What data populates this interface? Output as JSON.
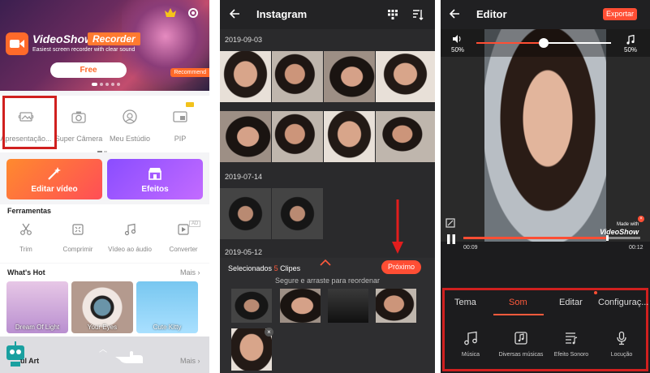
{
  "panel1": {
    "brand": "VideoShow",
    "brand_tag": "Recorder",
    "brand_sub": "Easiest screen recorder with clear sound",
    "free_label": "Free",
    "recommend": "Recommend",
    "tools": [
      "Apresentação...",
      "Super Câmera",
      "Meu Estúdio",
      "PIP"
    ],
    "edit_video": "Editar vídeo",
    "effects": "Efeitos",
    "ferramentas": "Ferramentas",
    "ftools": [
      "Trim",
      "Comprimir",
      "Vídeo ao áudio",
      "Converter"
    ],
    "ad_badge": "AD",
    "whats_hot": "What's Hot",
    "mais": "Mais",
    "hot_items": [
      "Dream Of Light",
      "Your Eyes",
      "Cute Kitty"
    ],
    "cut_section": "ul Art",
    "mais2": "Mais"
  },
  "panel2": {
    "title": "Instagram",
    "dates": [
      "2019-09-03",
      "2019-07-14",
      "2019-05-12"
    ],
    "selected_prefix": "Selecionados",
    "selected_count": "5",
    "selected_suffix": "Clipes",
    "next_label": "Próximo",
    "drag_hint": "Segure e arraste para reordenar",
    "close_x": "×"
  },
  "panel3": {
    "title": "Editor",
    "export": "Exportar",
    "vol_left": "50%",
    "vol_right": "50%",
    "wm_made": "Made with",
    "wm_brand": "VideoShow",
    "time_current": "00:09",
    "time_total": "00:12",
    "volume_level": 0.5,
    "progress_level": 0.81,
    "tabs": [
      "Tema",
      "Som",
      "Editar",
      "Configuraç..."
    ],
    "active_tab": "Som",
    "sound_tools": [
      "Música",
      "Diversas músicas",
      "Efeito Sonoro",
      "Locução"
    ]
  },
  "colors": {
    "accent": "#ff4e34",
    "highlight_box": "#d0201f",
    "orange": "#ff6a2a",
    "purple": "#8a4dff"
  },
  "icons": [
    "gear-icon",
    "crown-icon",
    "slideshow-icon",
    "camera-icon",
    "studio-icon",
    "pip-icon",
    "magic-wand-icon",
    "store-icon",
    "scissors-icon",
    "compress-icon",
    "music-note-icon",
    "convert-icon",
    "back-arrow-icon",
    "grid-icon",
    "sort-icon",
    "volume-icon",
    "pause-icon",
    "fullscreen-icon",
    "microphone-icon"
  ]
}
